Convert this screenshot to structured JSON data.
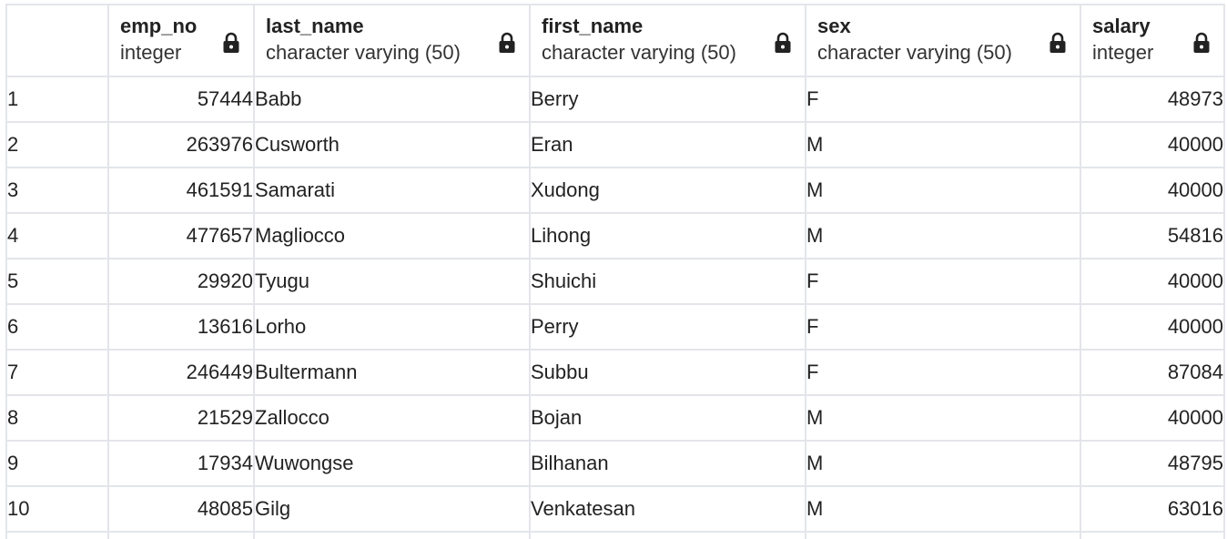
{
  "columns": [
    {
      "name": "emp_no",
      "type": "integer"
    },
    {
      "name": "last_name",
      "type": "character varying (50)"
    },
    {
      "name": "first_name",
      "type": "character varying (50)"
    },
    {
      "name": "sex",
      "type": "character varying (50)"
    },
    {
      "name": "salary",
      "type": "integer"
    }
  ],
  "lock_icon": "lock-icon",
  "rows": [
    {
      "num": "1",
      "emp_no": "57444",
      "last_name": "Babb",
      "first_name": "Berry",
      "sex": "F",
      "salary": "48973"
    },
    {
      "num": "2",
      "emp_no": "263976",
      "last_name": "Cusworth",
      "first_name": "Eran",
      "sex": "M",
      "salary": "40000"
    },
    {
      "num": "3",
      "emp_no": "461591",
      "last_name": "Samarati",
      "first_name": "Xudong",
      "sex": "M",
      "salary": "40000"
    },
    {
      "num": "4",
      "emp_no": "477657",
      "last_name": "Magliocco",
      "first_name": "Lihong",
      "sex": "M",
      "salary": "54816"
    },
    {
      "num": "5",
      "emp_no": "29920",
      "last_name": "Tyugu",
      "first_name": "Shuichi",
      "sex": "F",
      "salary": "40000"
    },
    {
      "num": "6",
      "emp_no": "13616",
      "last_name": "Lorho",
      "first_name": "Perry",
      "sex": "F",
      "salary": "40000"
    },
    {
      "num": "7",
      "emp_no": "246449",
      "last_name": "Bultermann",
      "first_name": "Subbu",
      "sex": "F",
      "salary": "87084"
    },
    {
      "num": "8",
      "emp_no": "21529",
      "last_name": "Zallocco",
      "first_name": "Bojan",
      "sex": "M",
      "salary": "40000"
    },
    {
      "num": "9",
      "emp_no": "17934",
      "last_name": "Wuwongse",
      "first_name": "Bilhanan",
      "sex": "M",
      "salary": "48795"
    },
    {
      "num": "10",
      "emp_no": "48085",
      "last_name": "Gilg",
      "first_name": "Venkatesan",
      "sex": "M",
      "salary": "63016"
    }
  ]
}
